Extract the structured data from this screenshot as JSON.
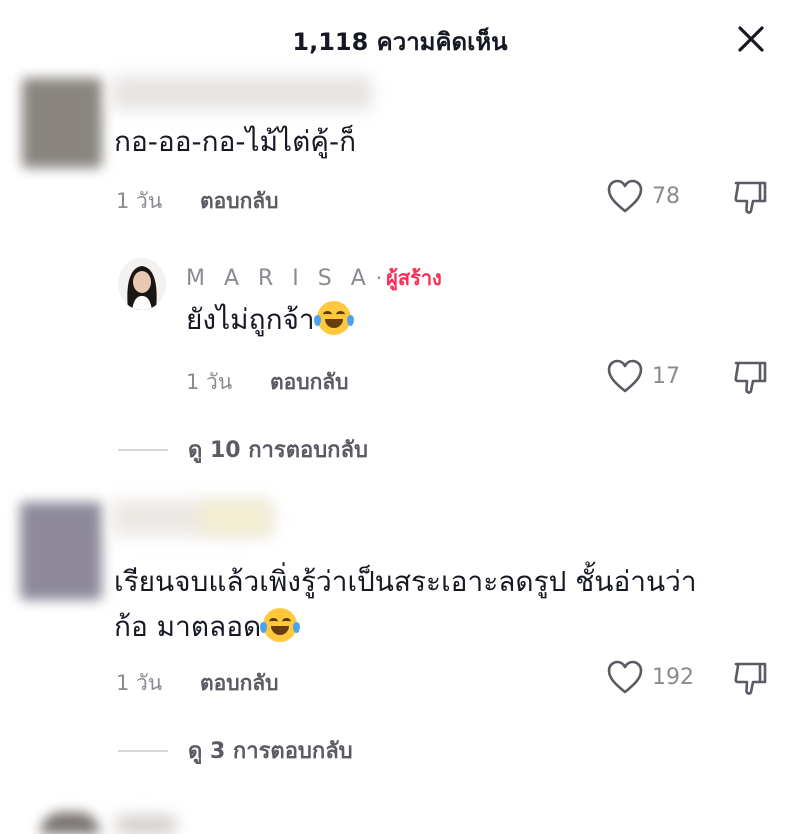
{
  "header": {
    "title": "1,118 ความคิดเห็น"
  },
  "icons": {
    "close": "close-icon",
    "like": "heart-outline-icon",
    "dislike": "thumbs-down-outline-icon",
    "emoji": "face-with-tears-of-joy-emoji"
  },
  "colors": {
    "creator_badge": "#fe2c55",
    "meta": "#8a8b91",
    "text": "#161823"
  },
  "comments": [
    {
      "text": "กอ-ออ-กอ-ไม้ไต่คู้-ก็",
      "time": "1 วัน",
      "reply_label": "ตอบกลับ",
      "likes": "78",
      "creator_reply": {
        "username": "M A R I S A",
        "separator": "·",
        "badge": "ผู้สร้าง",
        "text": "ยังไม่ถูกจ้า",
        "time": "1 วัน",
        "reply_label": "ตอบกลับ",
        "likes": "17"
      },
      "view_replies": "ดู 10 การตอบกลับ"
    },
    {
      "text_line1": "เรียนจบแล้วเพิ่งรู้ว่าเป็นสระเอาะลดรูป ชั้นอ่านว่า",
      "text_line2": "ก้อ มาตลอด",
      "time": "1 วัน",
      "reply_label": "ตอบกลับ",
      "likes": "192",
      "view_replies": "ดู 3 การตอบกลับ"
    }
  ]
}
